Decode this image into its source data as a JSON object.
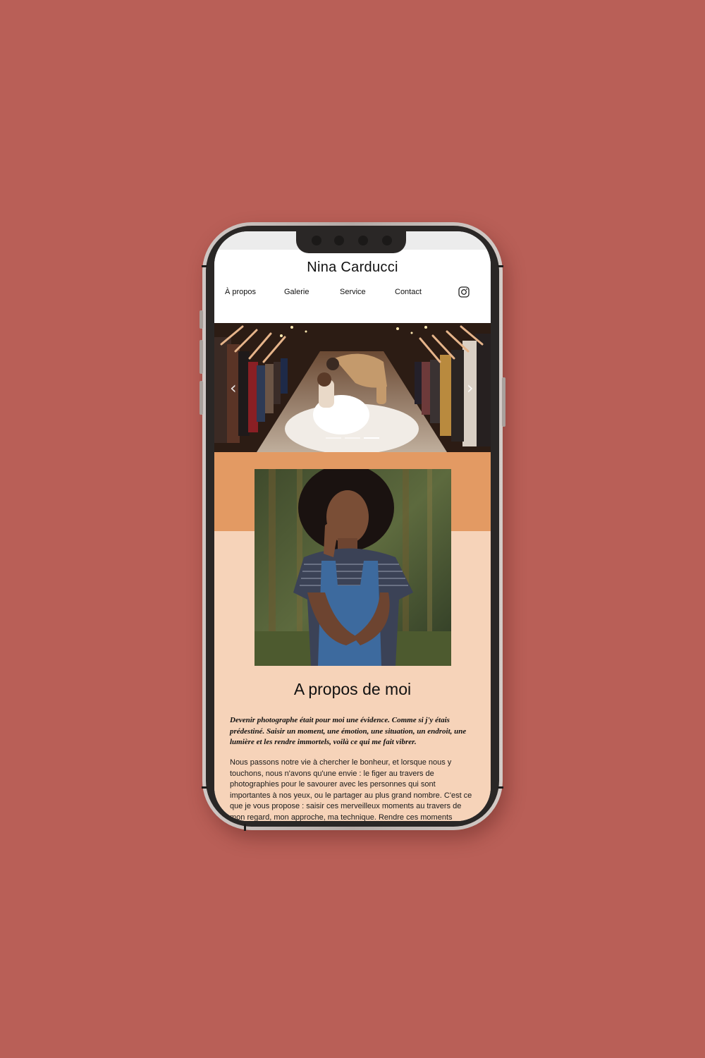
{
  "site": {
    "title": "Nina Carducci"
  },
  "nav": {
    "items": [
      "À propos",
      "Galerie",
      "Service",
      "Contact"
    ]
  },
  "icons": {
    "social": "instagram-icon",
    "prev": "chevron-left-icon",
    "next": "chevron-right-icon"
  },
  "hero": {
    "carousel_indicators": 3,
    "active_indicator": 3
  },
  "about": {
    "title": "A propos de moi",
    "intro": "Devenir photographe était pour moi une évidence. Comme si j'y étais prédestiné. Saisir un moment, une émotion, une situation, un endroit, une lumière et les rendre immortels, voilà ce qui me fait vibrer.",
    "body": "Nous passons notre vie à chercher le bonheur, et lorsque nous y touchons, nous n'avons qu'une envie : le figer au travers de photographies pour le savourer avec les personnes qui sont importantes à nos yeux, ou le partager au plus grand nombre. C'est ce que je vous propose : saisir ces merveilleux moments au travers de mon regard, mon approche, ma technique. Rendre ces moments"
  },
  "colors": {
    "background": "#b95f57",
    "accent": "#e39a63",
    "light": "#f6d3b9"
  }
}
